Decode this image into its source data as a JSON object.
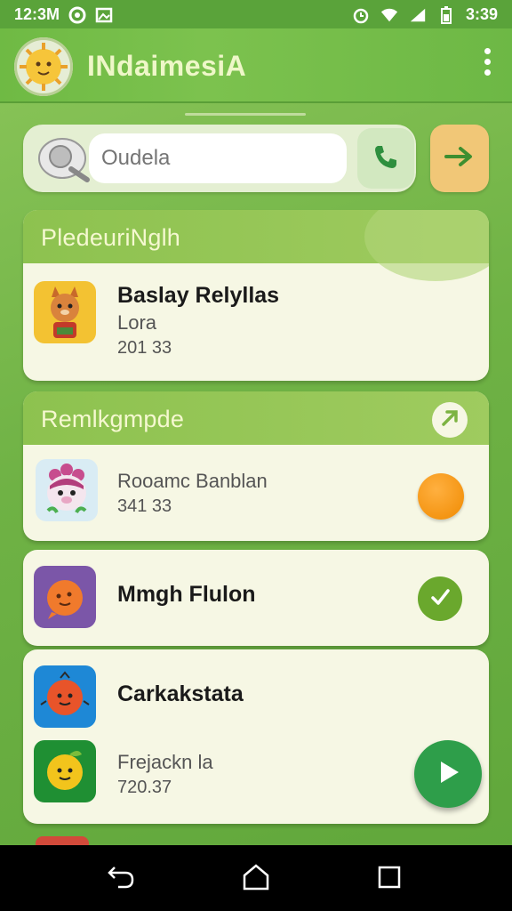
{
  "status_bar": {
    "time_left": "12:3M",
    "time_right": "3:39"
  },
  "app_bar": {
    "title": "INdaimesiA"
  },
  "search": {
    "placeholder": "Oudela",
    "value": ""
  },
  "section_one": {
    "title": "PledeuriNglh",
    "items": [
      {
        "title": "Baslay Relyllas",
        "subtitle": "Lora",
        "number": "201 33"
      }
    ]
  },
  "section_two": {
    "title": "Remlkgmpde",
    "items": [
      {
        "title": "Rooamc Banblan",
        "number": "341 33"
      }
    ]
  },
  "card_three": {
    "title": "Mmgh Flulon"
  },
  "card_four": {
    "items": [
      {
        "title": "Carkakstata"
      },
      {
        "subtitle": "Frejackn la",
        "number": "720.37"
      }
    ]
  },
  "colors": {
    "background": "#6fb245",
    "header_green": "#8dc24f",
    "card": "#f6f7e4",
    "orange_badge": "#f08a00",
    "fab": "#2e9e4a"
  },
  "icons": [
    "whatsapp-icon",
    "gallery-icon",
    "alarm-icon",
    "wifi-icon",
    "signal-icon",
    "battery-icon",
    "search-icon",
    "phone-icon",
    "arrow-icon",
    "check-icon",
    "play-icon",
    "back-icon",
    "home-icon",
    "recents-icon"
  ]
}
